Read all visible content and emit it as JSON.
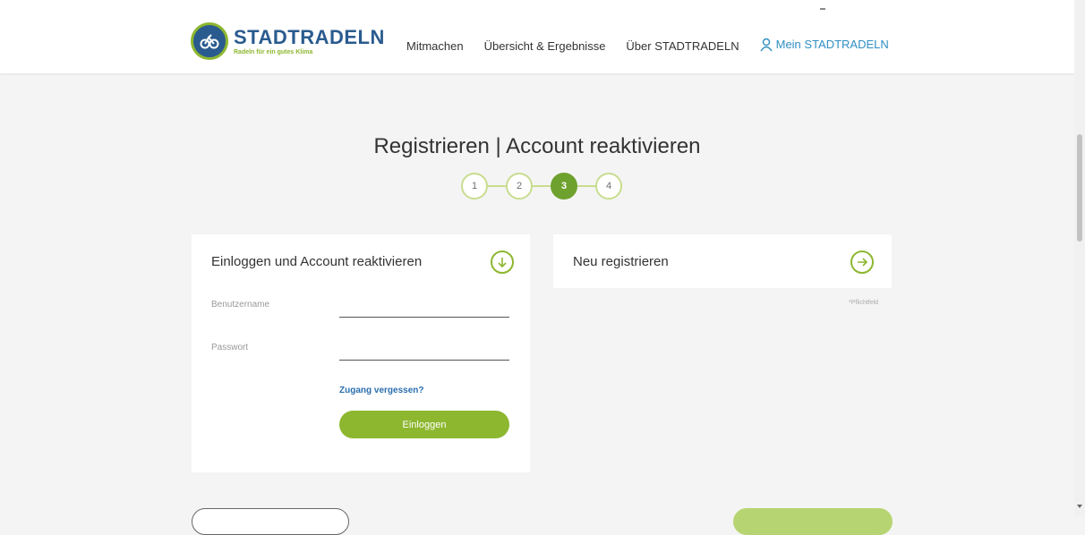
{
  "header": {
    "logo_name": "STADTRADELN",
    "logo_slogan": "Radeln für ein gutes Klima",
    "nav": [
      {
        "label": "Mitmachen"
      },
      {
        "label": "Übersicht & Ergebnisse"
      },
      {
        "label": "Über STADTRADELN"
      },
      {
        "label": "Mein STADTRADELN",
        "icon": "user-icon"
      }
    ],
    "accent_color": "#2f8fc4"
  },
  "title": "Registrieren | Account reaktivieren",
  "steps": {
    "items": [
      "1",
      "2",
      "3",
      "4"
    ],
    "active": "3"
  },
  "login_card": {
    "title": "Einloggen und Account reaktivieren",
    "icon": "arrow-down-circle-icon",
    "username_label": "Benutzername",
    "username_value": "",
    "password_label": "Passwort",
    "password_value": "",
    "forgot_link": "Zugang vergessen?",
    "login_button": "Einloggen"
  },
  "register_card": {
    "title": "Neu registrieren",
    "icon": "arrow-right-circle-icon"
  },
  "required_note": "*Pflichtfeld",
  "colors": {
    "brand_green": "#8db72f",
    "brand_blue": "#2a5b8f",
    "active_step": "#6ea12e"
  }
}
